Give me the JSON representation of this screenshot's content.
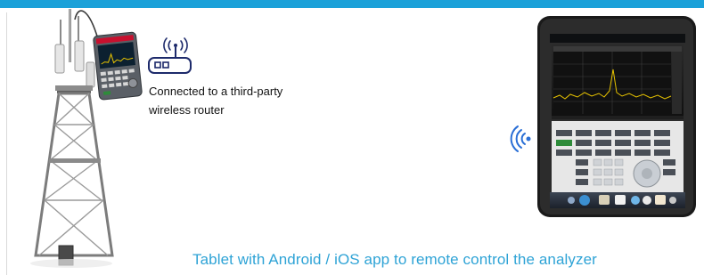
{
  "captions": {
    "router": "Connected to a third-party wireless router",
    "tablet": "Tablet with Android / iOS app to remote control the analyzer"
  },
  "colors": {
    "accent": "#1ba1d9",
    "tablet_caption": "#2ea3d6",
    "analyzer_body": "#c8102e",
    "trace": "#e6c200",
    "keypad_green": "#2e8b3a"
  },
  "icons": {
    "router": "wifi-router-icon",
    "wireless": "wireless-signal-icon",
    "tower": "cell-tower-icon",
    "analyzer": "handheld-spectrum-analyzer-icon",
    "tablet": "tablet-device-icon"
  }
}
